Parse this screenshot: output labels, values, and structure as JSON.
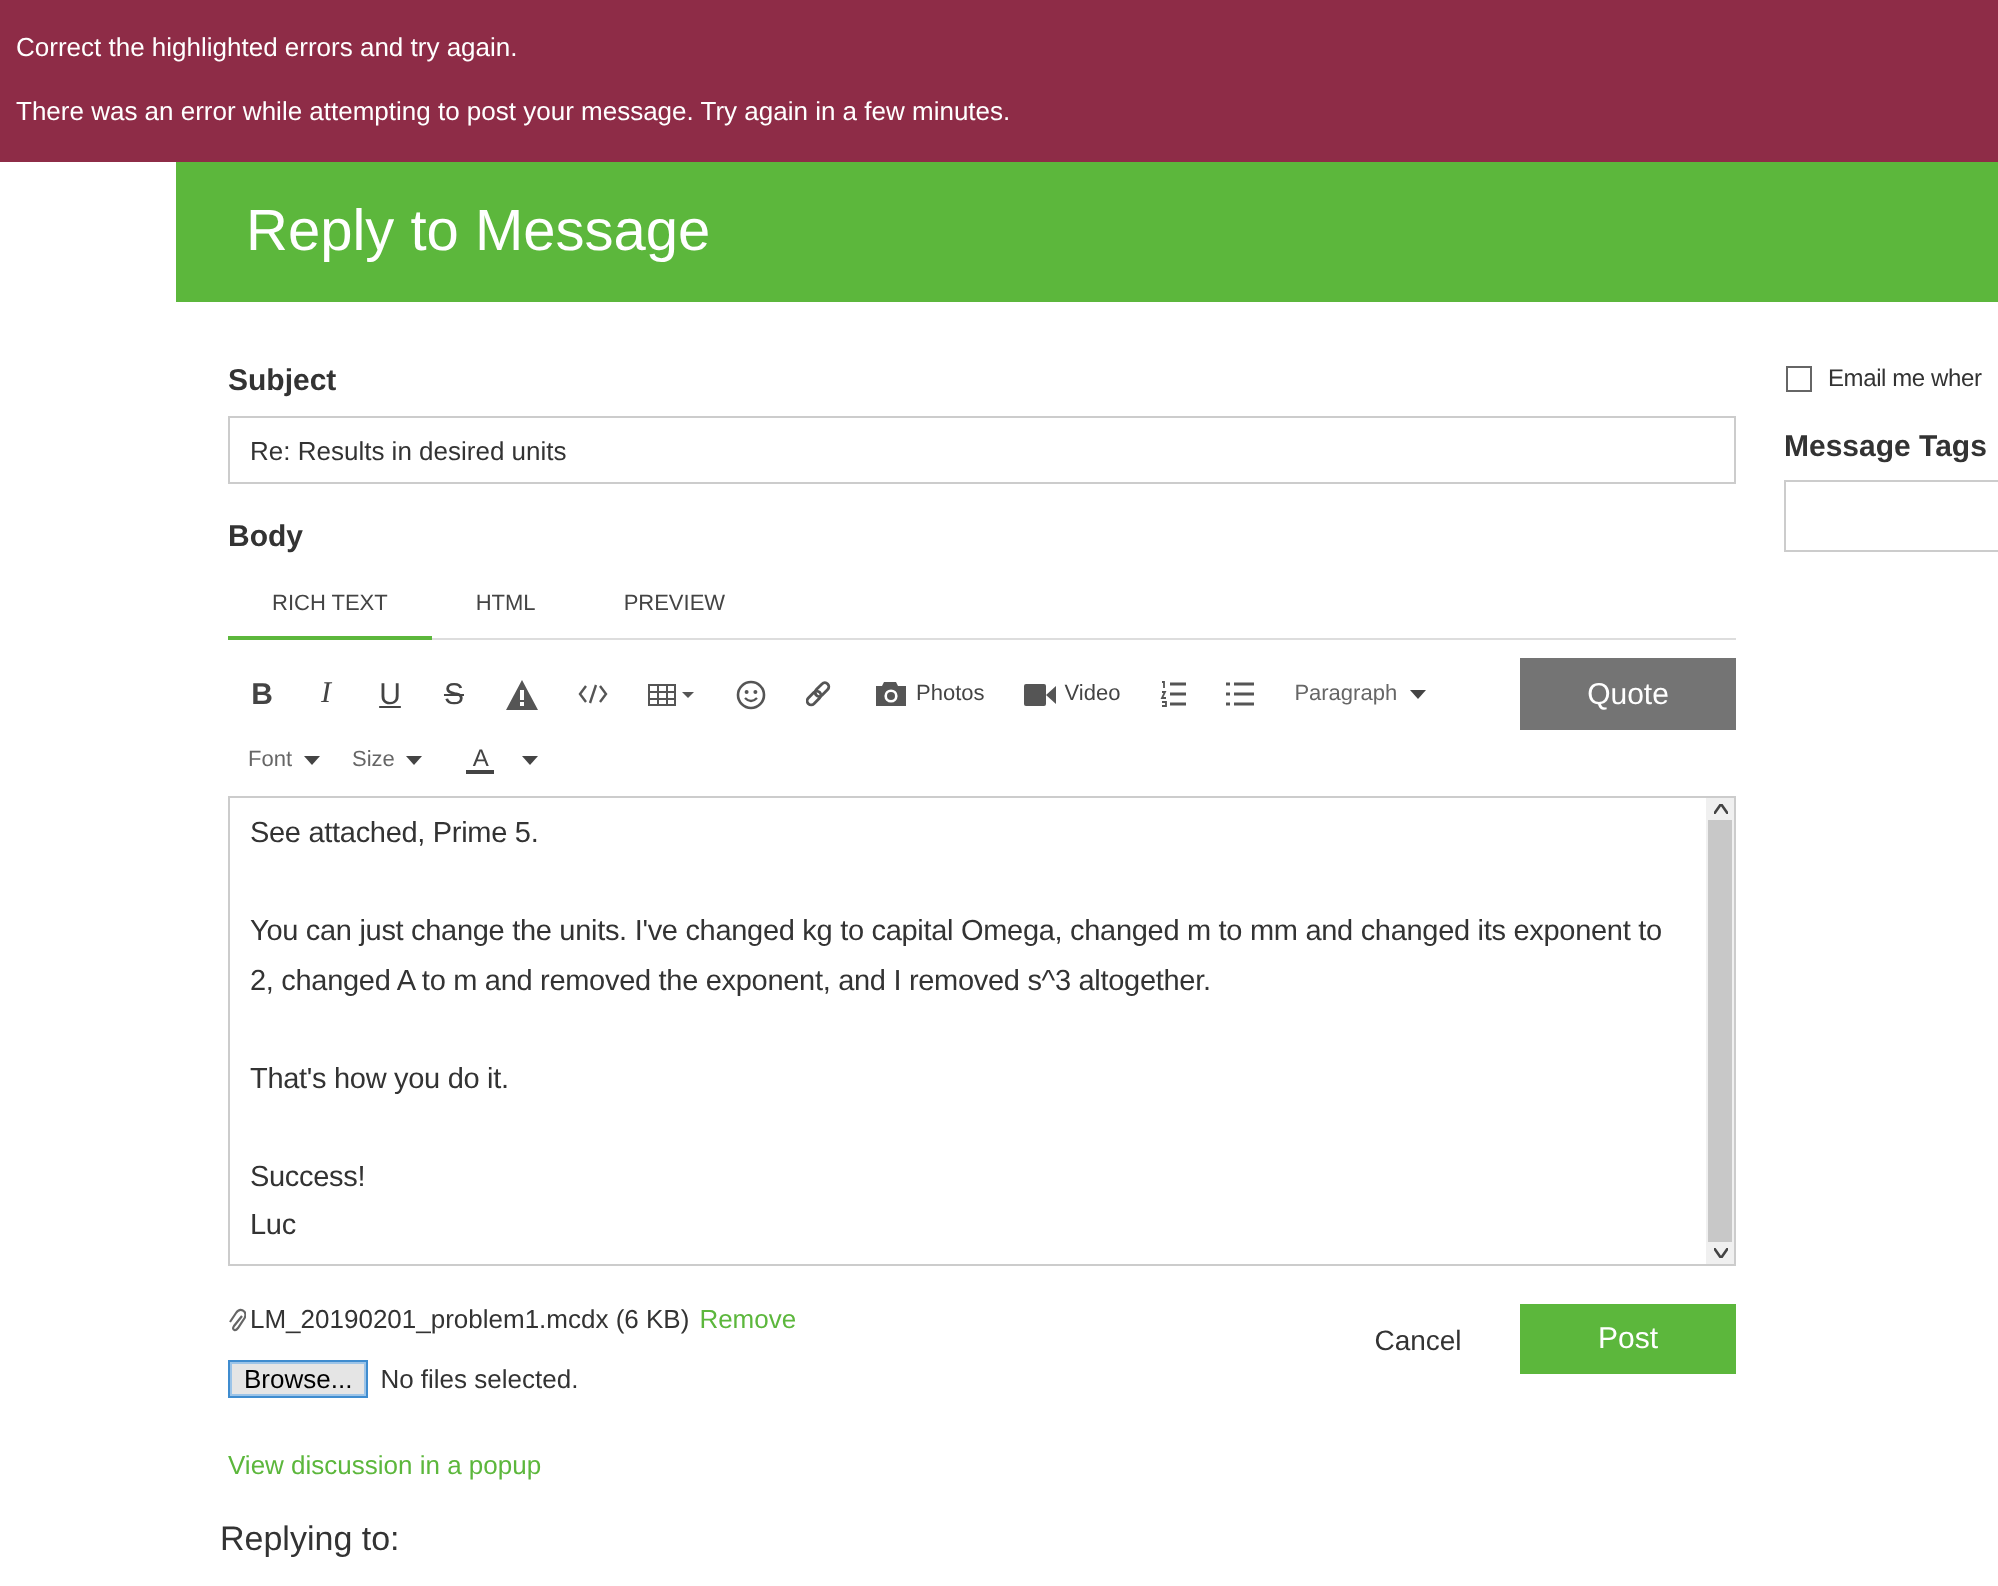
{
  "errors": [
    "Correct the highlighted errors and try again.",
    "There was an error while attempting to post your message. Try again in a few minutes."
  ],
  "header": {
    "title": "Reply to Message"
  },
  "subject": {
    "label": "Subject",
    "value": "Re: Results in desired units"
  },
  "body": {
    "label": "Body",
    "tabs": [
      {
        "label": "RICH TEXT",
        "selected": true
      },
      {
        "label": "HTML",
        "selected": false
      },
      {
        "label": "PREVIEW",
        "selected": false
      }
    ],
    "toolbar": [
      {
        "kind": "bold",
        "label": "B"
      },
      {
        "kind": "italic",
        "label": "I"
      },
      {
        "kind": "underline",
        "label": "U"
      },
      {
        "kind": "strike",
        "label": "S"
      },
      {
        "kind": "warning"
      },
      {
        "kind": "code"
      },
      {
        "kind": "table"
      },
      {
        "kind": "emoji"
      },
      {
        "kind": "link"
      },
      {
        "kind": "photos",
        "label": "Photos"
      },
      {
        "kind": "video",
        "label": "Video"
      },
      {
        "kind": "ordered-list"
      },
      {
        "kind": "bullet-list"
      },
      {
        "kind": "dropdown",
        "label": "Paragraph"
      }
    ],
    "quote_button": "Quote",
    "toolbar2": [
      {
        "kind": "dropdown",
        "label": "Font"
      },
      {
        "kind": "dropdown",
        "label": "Size"
      },
      {
        "kind": "color",
        "label": "A"
      }
    ],
    "paragraphs": [
      [
        "See attached, Prime 5."
      ],
      [
        "You can just change the units. I've changed kg to capital Omega, changed m to mm and changed its exponent to 2, changed A to m and removed the exponent, and I removed s^3 altogether."
      ],
      [
        "That's how you do it."
      ],
      [
        "Success!",
        "Luc"
      ]
    ]
  },
  "attachment": {
    "name": "LM_20190201_problem1.mcdx (6 KB)",
    "remove": "Remove"
  },
  "file_input": {
    "button": "Browse...",
    "status": "No files selected."
  },
  "buttons": {
    "cancel": "Cancel",
    "post": "Post"
  },
  "popup_link": "View discussion in a popup",
  "replying_to": "Replying to:",
  "sidebar": {
    "email": {
      "label": "Email me wher",
      "checked": false
    },
    "tags": {
      "label": "Message Tags"
    }
  }
}
